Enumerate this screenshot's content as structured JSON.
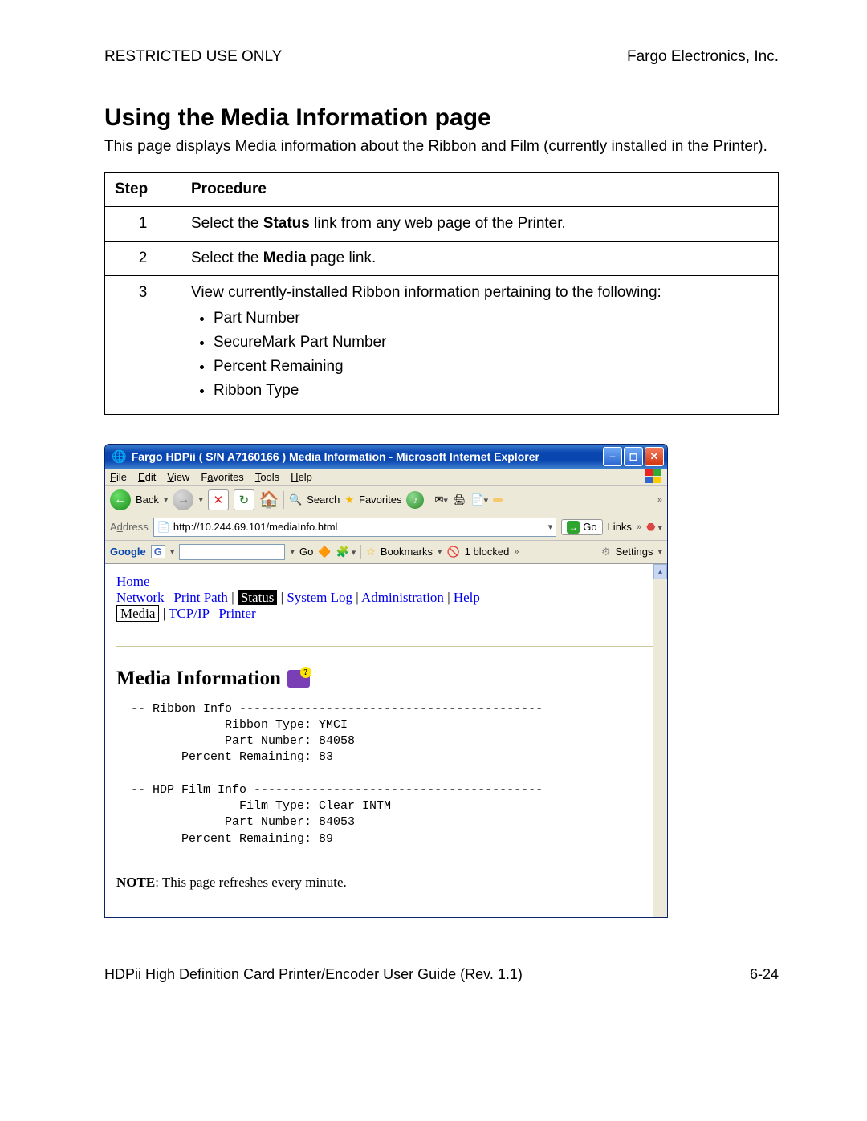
{
  "header": {
    "left": "RESTRICTED USE ONLY",
    "right": "Fargo Electronics, Inc."
  },
  "title": "Using the Media Information page",
  "intro": "This page displays Media information about the Ribbon and Film (currently installed in the Printer).",
  "table": {
    "head_step": "Step",
    "head_proc": "Procedure",
    "r1_step": "1",
    "r1_a": "Select the ",
    "r1_b": "Status",
    "r1_c": " link from any web page of the Printer.",
    "r2_step": "2",
    "r2_a": "Select the ",
    "r2_b": "Media",
    "r2_c": " page link.",
    "r3_step": "3",
    "r3_intro": "View currently-installed Ribbon information pertaining to the following:",
    "r3_b1": "Part Number",
    "r3_b2": "SecureMark Part Number",
    "r3_b3": "Percent Remaining",
    "r3_b4": "Ribbon Type"
  },
  "ie": {
    "title": "Fargo HDPii ( S/N A7160166 ) Media Information - Microsoft Internet Explorer",
    "menu": {
      "file": "File",
      "edit": "Edit",
      "view": "View",
      "fav": "Favorites",
      "tools": "Tools",
      "help": "Help"
    },
    "tb": {
      "back": "Back",
      "search": "Search",
      "favorites": "Favorites"
    },
    "addr_label": "Address",
    "addr_value": "http://10.244.69.101/mediaInfo.html",
    "go": "Go",
    "links": "Links",
    "google": "Google",
    "go2": "Go",
    "bookmarks": "Bookmarks",
    "blocked": "1 blocked",
    "settings": "Settings"
  },
  "nav": {
    "home": "Home",
    "network": "Network",
    "printpath": "Print Path",
    "status": "Status",
    "syslog": "System Log",
    "admin": "Administration",
    "help": "Help",
    "media": "Media",
    "tcpip": "TCP/IP",
    "printer": "Printer"
  },
  "content": {
    "heading": "Media Information",
    "pre": "  -- Ribbon Info ------------------------------------------\n               Ribbon Type: YMCI\n               Part Number: 84058\n         Percent Remaining: 83\n\n  -- HDP Film Info ----------------------------------------\n                 Film Type: Clear INTM\n               Part Number: 84053\n         Percent Remaining: 89",
    "note_b": "NOTE",
    "note_t": ": This page refreshes every minute."
  },
  "footer": {
    "left": "HDPii High Definition Card Printer/Encoder User Guide (Rev. 1.1)",
    "right": "6-24"
  },
  "chart_data": {
    "type": "table",
    "title": "Media Information",
    "sections": [
      {
        "name": "Ribbon Info",
        "fields": {
          "Ribbon Type": "YMCI",
          "Part Number": "84058",
          "Percent Remaining": 83
        }
      },
      {
        "name": "HDP Film Info",
        "fields": {
          "Film Type": "Clear INTM",
          "Part Number": "84053",
          "Percent Remaining": 89
        }
      }
    ]
  }
}
